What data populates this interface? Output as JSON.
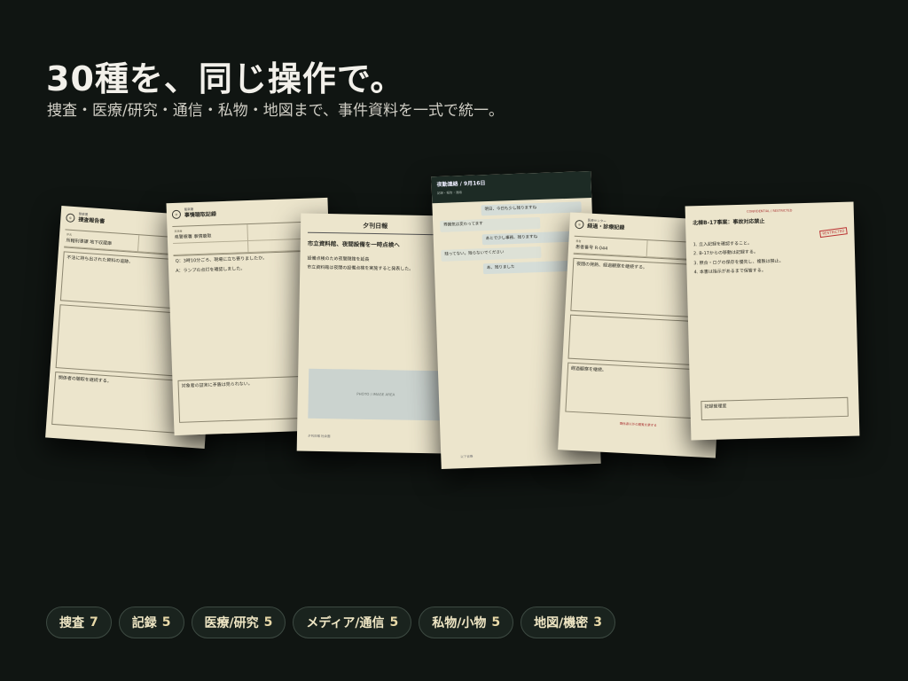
{
  "headline": "30種を、同じ操作で。",
  "subheadline": "捜査・医療/研究・通信・私物・地図まで、事件資料を一式で統一。",
  "docs": {
    "d1": {
      "title": "捜査報告書",
      "org": "警察署",
      "line1": "所轄刑事課 地下収蔵庫",
      "body": "不法に持ち出された資料の追跡。",
      "note": "関係者の聴取を継続する。"
    },
    "d2": {
      "title": "事情聴取記録",
      "org": "警察署",
      "line1": "県警察署 事情聴取",
      "body1": "Q：3時10分ごろ、現場に立ち寄りましたか。",
      "body2": "A：ランプの点灯を確認しました。",
      "note": "対象者の証言に矛盾は見られない。"
    },
    "d3": {
      "paper": "夕刊日報",
      "headline": "市立資料館、夜間設備を一時点検へ",
      "lead": "設備点検のため夜間閉館を延長",
      "body": "市立資料館は夜間の設備点検を実施すると発表した。",
      "photo": "PHOTO / IMAGE AREA",
      "foot": "夕刊日報 社会面"
    },
    "d4": {
      "header": "夜勤連絡 / 9月16日",
      "sub": "記録・報告・連絡",
      "m1": "明日、今日も少し残りますね",
      "m2": "雰囲気は変わってます",
      "m3": "あとで少し事務、残りますね",
      "m4": "残ってない。残らないでください",
      "m5": "あ、残りました",
      "foot": "以下省略"
    },
    "d5": {
      "title": "経過・診療記録",
      "org": "医療センター",
      "line1": "患者番号 R-044",
      "body": "夜間の発熱、経過観察を継続する。",
      "note": "経過観察を継続。",
      "warn": "関係者以外の閲覧を禁ずる"
    },
    "d6": {
      "banner": "CONFIDENTIAL / RESTRICTED",
      "title": "北棟B-17事案：事故対応禁止",
      "stamp": "RESTRICTED",
      "b1": "1. 立入記録を確認すること。",
      "b2": "2. B-17からの移動は記録する。",
      "b3": "3. 照合・ログの保存を優先し、複製は禁止。",
      "b4": "4. 本書は指示があるまで保管する。",
      "foot": "記録管理室"
    }
  },
  "pills": [
    {
      "label": "捜査",
      "count": "7"
    },
    {
      "label": "記録",
      "count": "5"
    },
    {
      "label": "医療/研究",
      "count": "5"
    },
    {
      "label": "メディア/通信",
      "count": "5"
    },
    {
      "label": "私物/小物",
      "count": "5"
    },
    {
      "label": "地図/機密",
      "count": "3"
    }
  ]
}
